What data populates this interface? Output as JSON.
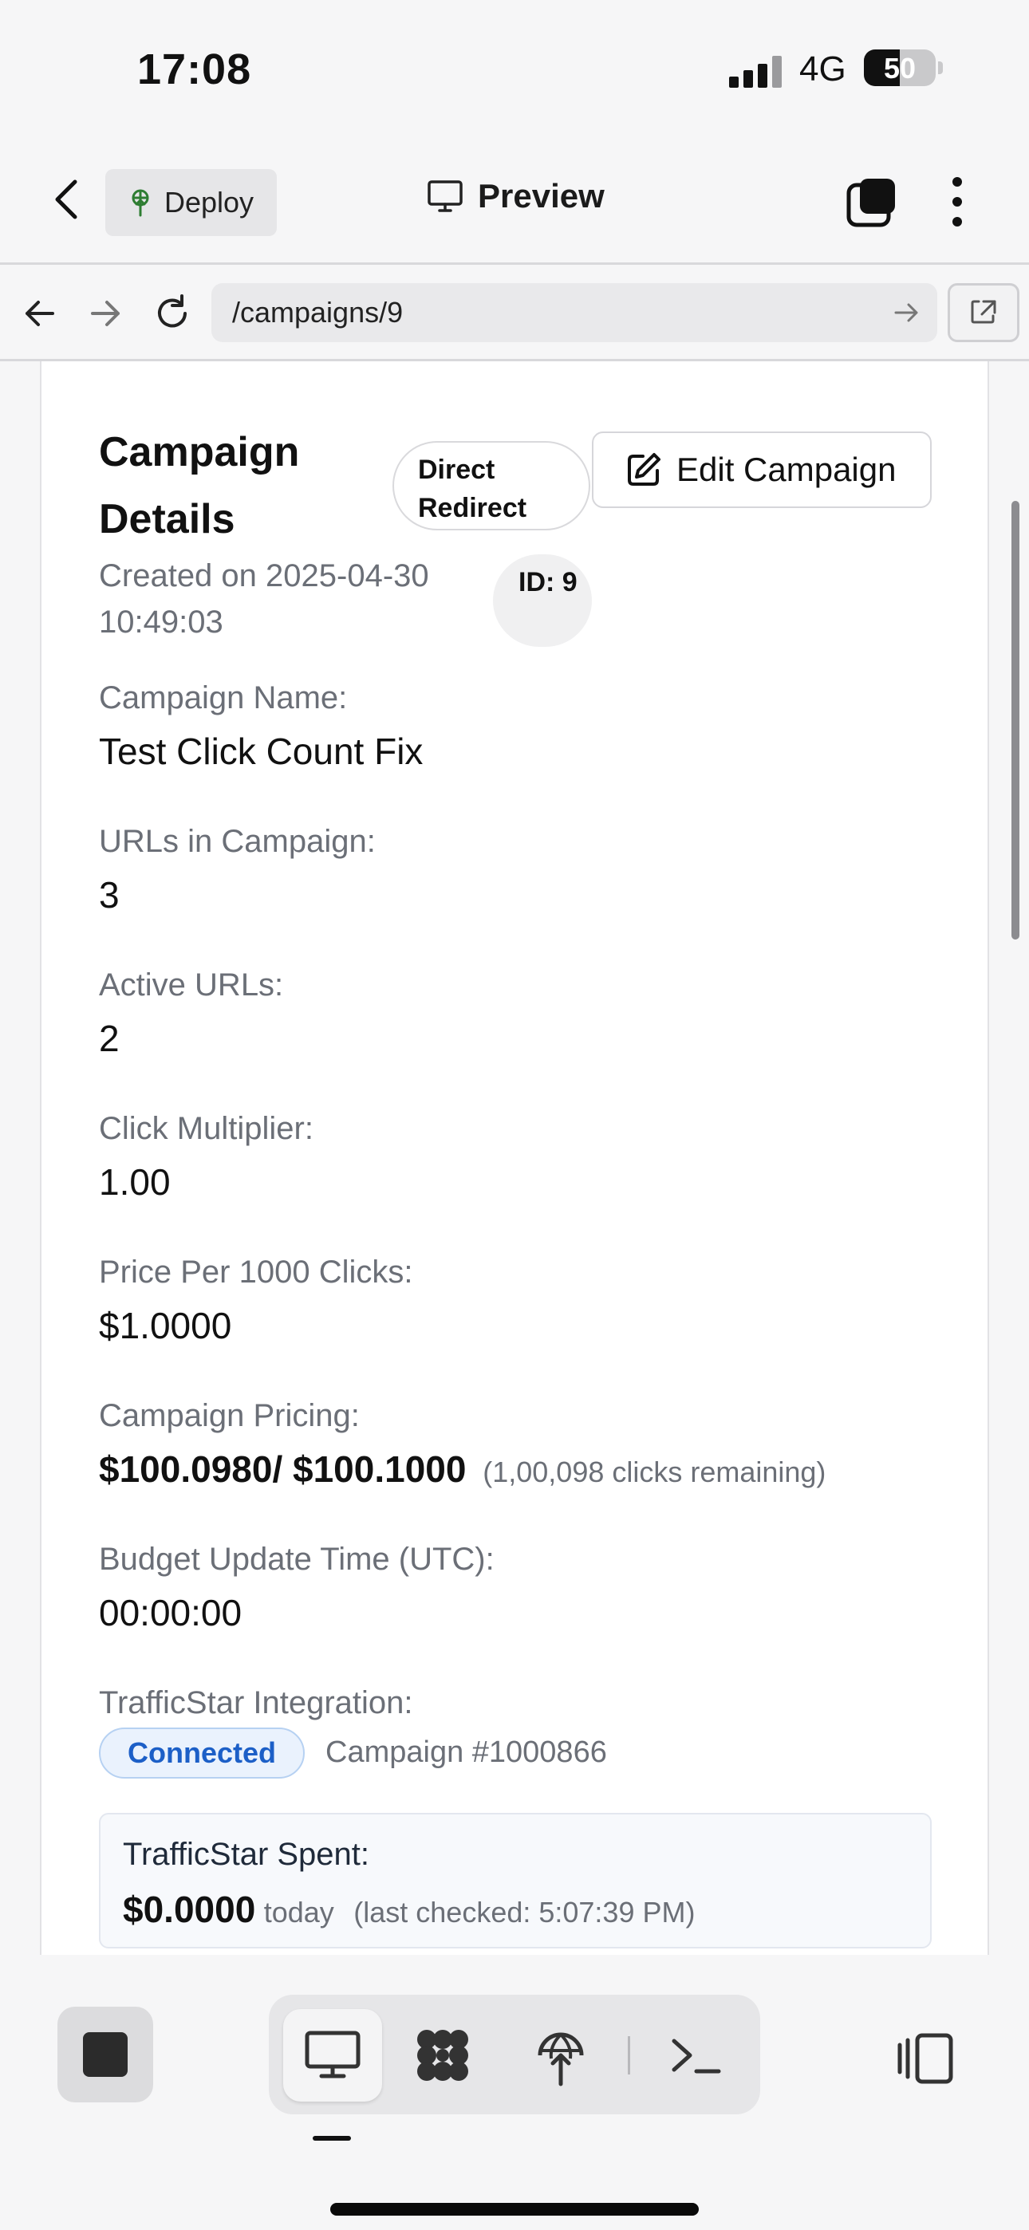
{
  "status_bar": {
    "time": "17:08",
    "network": "4G",
    "battery": "50",
    "battery_level": 0.5
  },
  "header": {
    "deploy_label": "Deploy",
    "title": "Preview"
  },
  "browser": {
    "url": "/campaigns/9"
  },
  "campaign": {
    "title": "Campaign Details",
    "mode_badge": "Direct Redirect",
    "edit_label": "Edit Campaign",
    "created": "Created on 2025-04-30 10:49:03",
    "id_badge": "ID: 9",
    "fields": {
      "name_label": "Campaign Name:",
      "name_value": "Test Click Count Fix",
      "urls_label": "URLs in Campaign:",
      "urls_value": "3",
      "active_label": "Active URLs:",
      "active_value": "2",
      "multiplier_label": "Click Multiplier:",
      "multiplier_value": "1.00",
      "price_label": "Price Per 1000 Clicks:",
      "price_value": "$1.0000",
      "pricing_label": "Campaign Pricing:",
      "pricing_value": "$100.0980/ $100.1000",
      "pricing_note": "(1,00,098 clicks remaining)",
      "budget_label": "Budget Update Time (UTC):",
      "budget_value": "00:00:00",
      "integration_label": "TrafficStar Integration:",
      "integration_status": "Connected",
      "integration_campaign": "Campaign #1000866"
    },
    "spent": {
      "label": "TrafficStar Spent:",
      "amount": "$0.0000",
      "period": "today",
      "checked": "(last checked: 5:07:39 PM)"
    }
  },
  "colors": {
    "accent_blue": "#1c5fc7",
    "muted_text": "#6b6f77"
  }
}
